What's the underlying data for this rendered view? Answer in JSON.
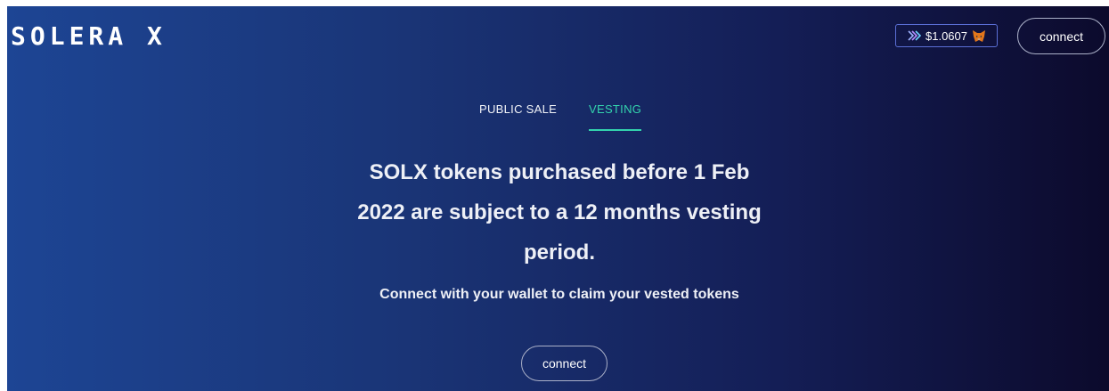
{
  "header": {
    "logo_text": "SOLERA X",
    "price": {
      "value": "$1.0607",
      "token_icon": "token-arrows-icon",
      "wallet_icon": "metamask-fox-icon"
    },
    "connect_label": "connect"
  },
  "tabs": [
    {
      "label": "PUBLIC SALE",
      "active": false
    },
    {
      "label": "VESTING",
      "active": true
    }
  ],
  "main": {
    "headline": "SOLX tokens purchased before 1 Feb 2022 are subject to a 12 months vesting period.",
    "subline": "Connect with your wallet to claim your vested tokens",
    "connect_label": "connect"
  },
  "colors": {
    "gradient_start": "#1d4594",
    "gradient_end": "#0c0a2c",
    "accent": "#33d3ad",
    "badge_border": "#5b6fd6"
  }
}
